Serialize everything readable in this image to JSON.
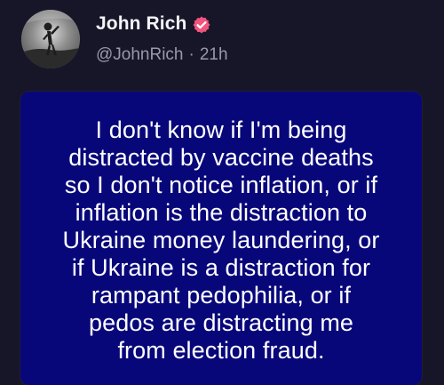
{
  "post": {
    "author": {
      "display_name": "John Rich",
      "handle": "@JohnRich",
      "verified": true,
      "avatar_icon": "profile-photo",
      "badge_icon": "verified-badge-icon",
      "badge_color": "#f2547d"
    },
    "time_separator": "·",
    "timestamp": "21h",
    "image_card": {
      "background_color": "#08077a",
      "text": "I don't know if I'm being\ndistracted by vaccine deaths\nso I don't notice inflation, or if\ninflation is the distraction to\nUkraine money laundering, or\nif Ukraine is a distraction for\nrampant pedophilia, or if\npedos are distracting me\nfrom election fraud."
    }
  }
}
